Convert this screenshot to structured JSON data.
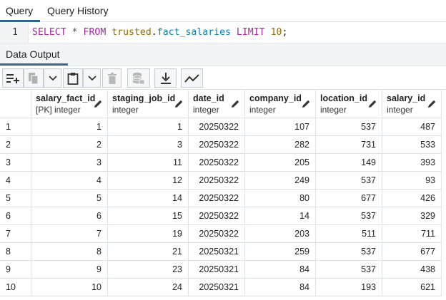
{
  "tabs": [
    {
      "label": "Query",
      "active": true
    },
    {
      "label": "Query History",
      "active": false
    }
  ],
  "editor": {
    "line_number": "1",
    "sql": {
      "select": "SELECT",
      "star": "*",
      "from": "FROM",
      "schema": "trusted",
      "table": "fact_salaries",
      "limit": "LIMIT",
      "limit_value": "10",
      "terminator": ";"
    }
  },
  "output_tab": "Data Output",
  "toolbar": {
    "icons": [
      "add-row-icon",
      "copy-icon",
      "chevron-down-icon",
      "paste-icon",
      "chevron-down-icon",
      "delete-icon",
      "save-data-icon",
      "download-icon",
      "graph-icon"
    ]
  },
  "colors": {
    "accent": "#326690",
    "keyword": "#a626a4",
    "identifier": "#986801",
    "field": "#0184bc"
  },
  "columns": [
    {
      "name": "salary_fact_id",
      "type": "[PK] integer"
    },
    {
      "name": "staging_job_id",
      "type": "integer"
    },
    {
      "name": "date_id",
      "type": "integer"
    },
    {
      "name": "company_id",
      "type": "integer"
    },
    {
      "name": "location_id",
      "type": "integer"
    },
    {
      "name": "salary_id",
      "type": "integer"
    }
  ],
  "rows": [
    {
      "n": "1",
      "cells": [
        "1",
        "1",
        "20250322",
        "107",
        "537",
        "487"
      ]
    },
    {
      "n": "2",
      "cells": [
        "2",
        "3",
        "20250322",
        "282",
        "731",
        "533"
      ]
    },
    {
      "n": "3",
      "cells": [
        "3",
        "11",
        "20250322",
        "205",
        "149",
        "393"
      ]
    },
    {
      "n": "4",
      "cells": [
        "4",
        "12",
        "20250322",
        "249",
        "537",
        "93"
      ]
    },
    {
      "n": "5",
      "cells": [
        "5",
        "14",
        "20250322",
        "80",
        "677",
        "426"
      ]
    },
    {
      "n": "6",
      "cells": [
        "6",
        "15",
        "20250322",
        "14",
        "537",
        "329"
      ]
    },
    {
      "n": "7",
      "cells": [
        "7",
        "19",
        "20250322",
        "203",
        "511",
        "711"
      ]
    },
    {
      "n": "8",
      "cells": [
        "8",
        "21",
        "20250321",
        "259",
        "537",
        "677"
      ]
    },
    {
      "n": "9",
      "cells": [
        "9",
        "23",
        "20250321",
        "84",
        "537",
        "438"
      ]
    },
    {
      "n": "10",
      "cells": [
        "10",
        "24",
        "20250321",
        "84",
        "193",
        "621"
      ]
    }
  ]
}
